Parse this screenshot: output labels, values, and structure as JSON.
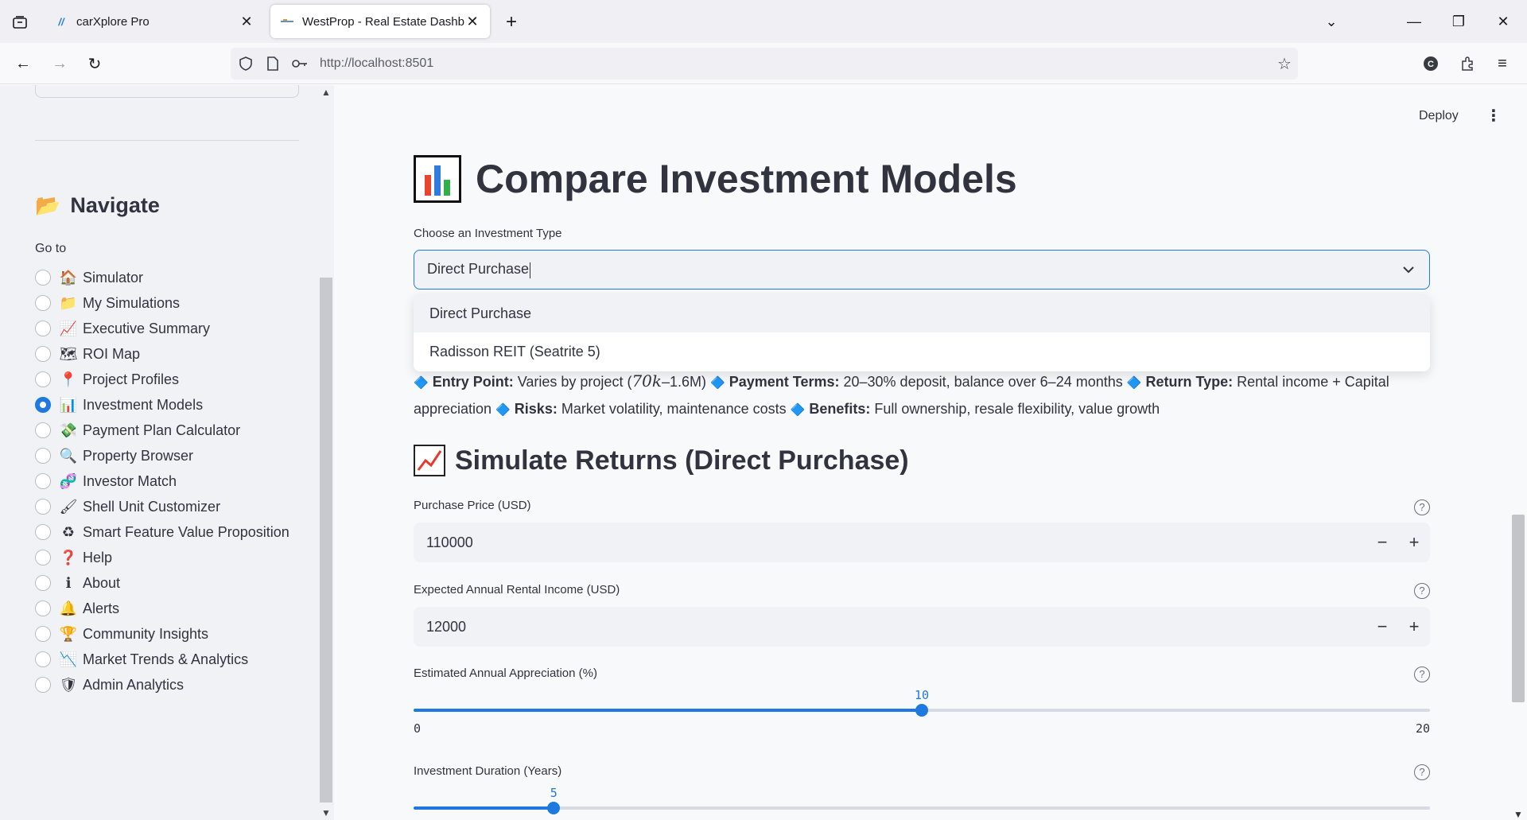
{
  "browser": {
    "tabs": [
      {
        "title": "carXplore Pro",
        "active": false
      },
      {
        "title": "WestProp - Real Estate Dashboard",
        "active": true
      }
    ],
    "url": "http://localhost:8501"
  },
  "sidebar": {
    "nav_title": "Navigate",
    "goto_label": "Go to",
    "items": [
      {
        "emoji": "🏠",
        "label": "Simulator"
      },
      {
        "emoji": "📁",
        "label": "My Simulations"
      },
      {
        "emoji": "📈",
        "label": "Executive Summary"
      },
      {
        "emoji": "🗺",
        "label": "ROI Map"
      },
      {
        "emoji": "📍",
        "label": "Project Profiles"
      },
      {
        "emoji": "📊",
        "label": "Investment Models"
      },
      {
        "emoji": "💸",
        "label": "Payment Plan Calculator"
      },
      {
        "emoji": "🔍",
        "label": "Property Browser"
      },
      {
        "emoji": "🧬",
        "label": "Investor Match"
      },
      {
        "emoji": "🖌",
        "label": "Shell Unit Customizer"
      },
      {
        "emoji": "♻",
        "label": "Smart Feature Value Proposition"
      },
      {
        "emoji": "❓",
        "label": "Help"
      },
      {
        "emoji": "ℹ",
        "label": "About"
      },
      {
        "emoji": "🔔",
        "label": "Alerts"
      },
      {
        "emoji": "🏆",
        "label": "Community Insights"
      },
      {
        "emoji": "📉",
        "label": "Market Trends & Analytics"
      },
      {
        "emoji": "🛡",
        "label": "Admin Analytics"
      }
    ],
    "selected_index": 5
  },
  "header": {
    "deploy_label": "Deploy"
  },
  "main": {
    "title": "Compare Investment Models",
    "select_label": "Choose an Investment Type",
    "select_value": "Direct Purchase",
    "dropdown_options": [
      "Direct Purchase",
      "Radisson REIT (Seatrite 5)"
    ],
    "info": {
      "entry_point_label": "Entry Point:",
      "entry_point_pre": "Varies by project (",
      "entry_point_math": "70k",
      "entry_point_post": "–1.6M)",
      "payment_terms_label": "Payment Terms:",
      "payment_terms": "20–30% deposit, balance over 6–24 months",
      "return_type_label": "Return Type:",
      "return_type": "Rental income + Capital appreciation",
      "risks_label": "Risks:",
      "risks": "Market volatility, maintenance costs",
      "benefits_label": "Benefits:",
      "benefits": "Full ownership, resale flexibility, value growth"
    },
    "sim_title": "Simulate Returns (Direct Purchase)",
    "purchase_price_label": "Purchase Price (USD)",
    "purchase_price_value": "110000",
    "rental_income_label": "Expected Annual Rental Income (USD)",
    "rental_income_value": "12000",
    "appreciation": {
      "label": "Estimated Annual Appreciation (%)",
      "value": 10,
      "min": 0,
      "max": 20
    },
    "duration": {
      "label": "Investment Duration (Years)",
      "value": 5
    }
  },
  "colors": {
    "accent": "#1f7ae0",
    "sidebar_bg": "#f0f2f6",
    "main_bg": "#f8f9fb",
    "text": "#31333f"
  }
}
